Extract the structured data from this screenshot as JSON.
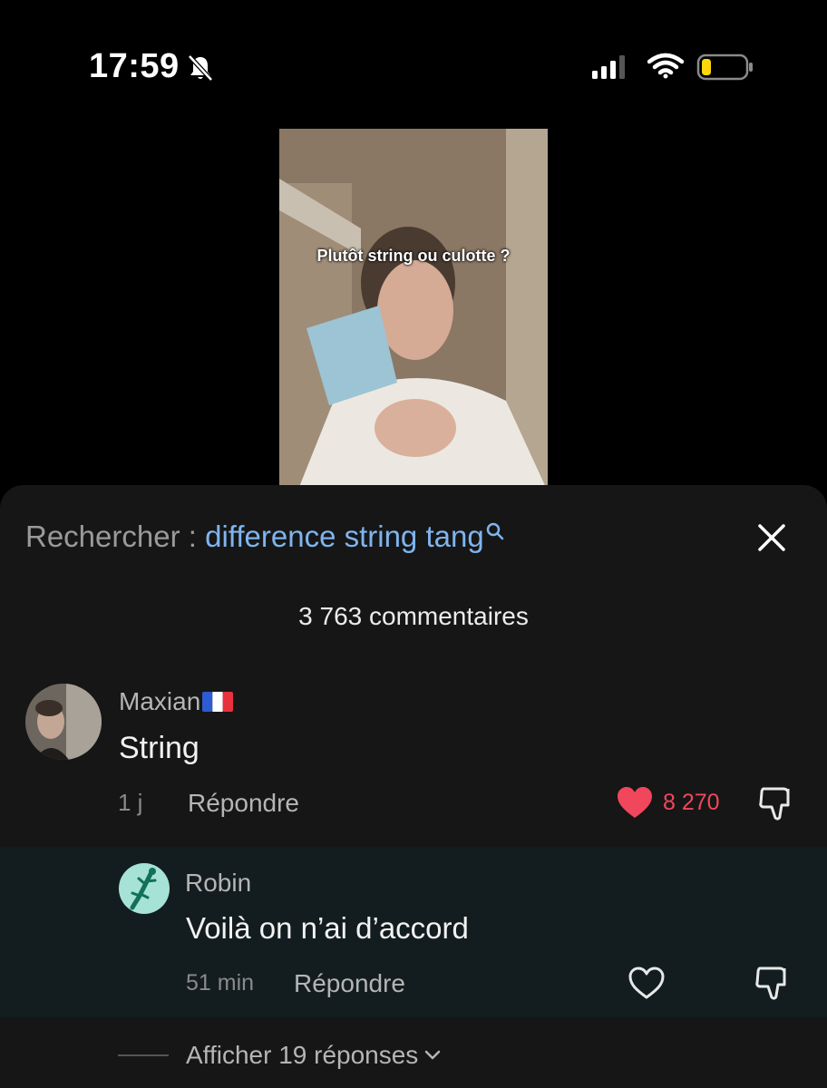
{
  "status_bar": {
    "time": "17:59",
    "icons": [
      "bell-slash-icon",
      "signal-icon",
      "wifi-icon",
      "battery-low-icon"
    ],
    "battery_color": "#ffd60a"
  },
  "video": {
    "caption": "Plutôt string ou culotte ?"
  },
  "search": {
    "prefix": "Rechercher : ",
    "query": "difference string tang",
    "query_color": "#7fb4ee"
  },
  "comments_header": {
    "count_label": "3 763 commentaires"
  },
  "comments": [
    {
      "user": "Maxian",
      "flag_icon": "france-flag-icon",
      "text": "String",
      "time": "1 j",
      "reply_label": "Répondre",
      "likes": "8 270",
      "liked": true,
      "like_color": "#f0475c"
    }
  ],
  "reply": {
    "user": "Robin",
    "text": "Voilà on n’ai d’accord",
    "time": "51 min",
    "reply_label": "Répondre",
    "liked": false
  },
  "more_replies": {
    "label": "Afficher 19 réponses"
  }
}
